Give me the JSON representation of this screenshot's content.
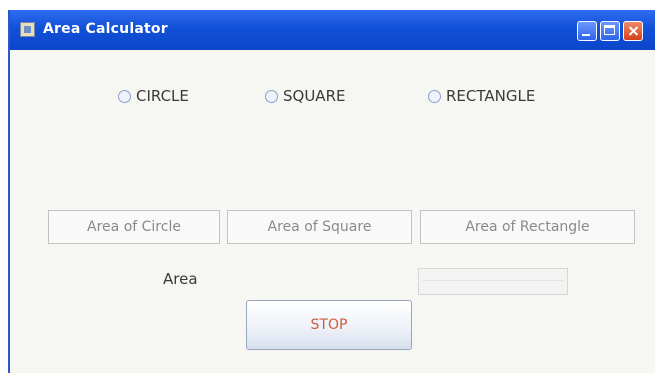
{
  "window": {
    "title": "Area Calculator",
    "title_icon": "java-app-icon",
    "controls": [
      "minimize-icon",
      "maximize-icon",
      "close-icon"
    ],
    "accent_color": "#1150d8"
  },
  "shapes": [
    {
      "label": "CIRCLE",
      "selected": false
    },
    {
      "label": "SQUARE",
      "selected": false
    },
    {
      "label": "RECTANGLE",
      "selected": false
    }
  ],
  "buttons": {
    "circle": "Area of Circle",
    "square": "Area of Square",
    "rectangle": "Area of Rectangle",
    "stop": "STOP"
  },
  "result": {
    "label": "Area",
    "value": ""
  }
}
